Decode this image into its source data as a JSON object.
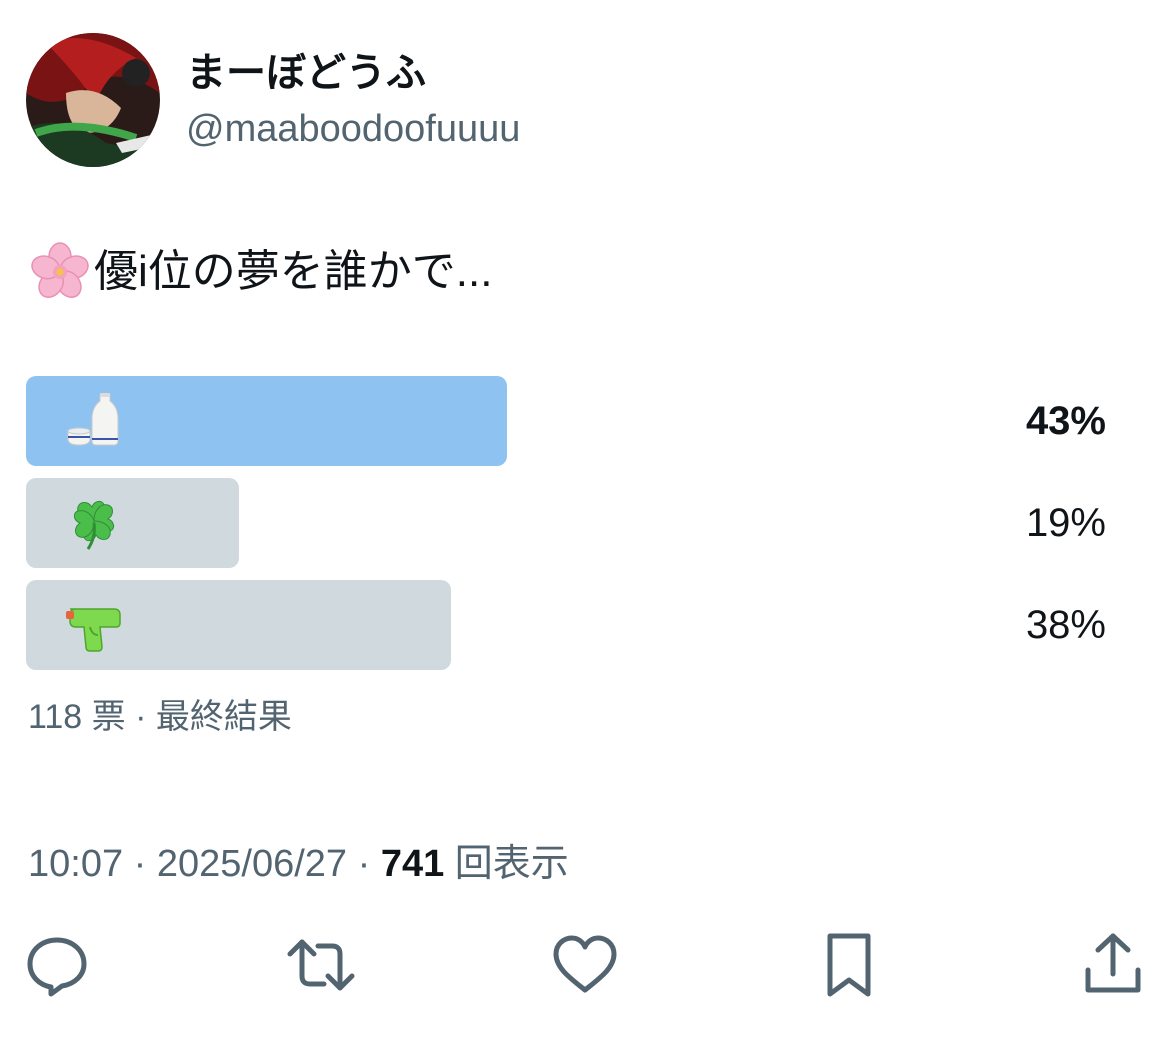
{
  "author": {
    "display_name": "まーぼどうふ",
    "handle": "@maaboodoofuuuu",
    "avatar_icon": "avatar-image"
  },
  "tweet": {
    "emoji_icon": "cherry-blossom-icon",
    "text": "優i位の夢を誰かで..."
  },
  "poll": {
    "options": [
      {
        "icon": "sake-icon",
        "percent": 43,
        "percent_label": "43%",
        "winner": true
      },
      {
        "icon": "four-leaf-clover-icon",
        "percent": 19,
        "percent_label": "19%",
        "winner": false
      },
      {
        "icon": "water-pistol-icon",
        "percent": 38,
        "percent_label": "38%",
        "winner": false
      }
    ],
    "meta": "118 票 · 最終結果"
  },
  "timestamp": {
    "time_date": "10:07 · 2025/06/27 · ",
    "views_count": "741",
    "views_label": " 回表示"
  },
  "actions": [
    {
      "name": "reply-icon"
    },
    {
      "name": "retweet-icon"
    },
    {
      "name": "like-icon"
    },
    {
      "name": "bookmark-icon"
    },
    {
      "name": "share-icon"
    }
  ],
  "colors": {
    "winner_bar": "#8ec3f1",
    "other_bar": "#cfd9de",
    "secondary_text": "#536471",
    "icon_color": "#536471"
  }
}
